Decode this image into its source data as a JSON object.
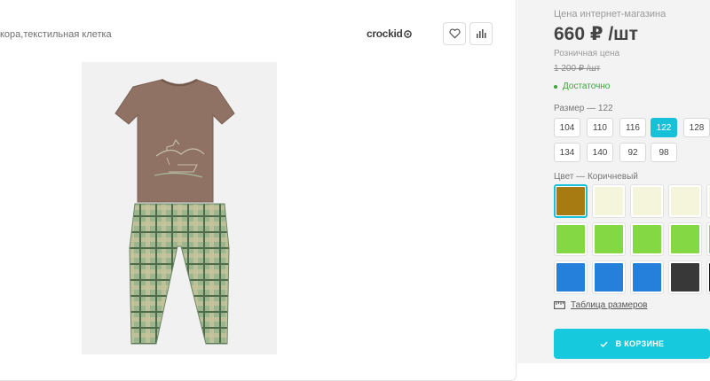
{
  "product": {
    "title": "кора,текстильная клетка",
    "brand": "crockid",
    "image_icon": "pajama-set-image"
  },
  "toolbar": {
    "favorite_icon": "heart-icon",
    "compare_icon": "bar-chart-icon"
  },
  "pricing": {
    "online_label": "Цена интернет-магазина",
    "online_price": "660 ₽ /шт",
    "retail_label": "Розничная цена",
    "retail_price": "1 200 ₽ /шт",
    "stock": "Достаточно"
  },
  "size": {
    "label": "Размер  —  122",
    "options": [
      "104",
      "110",
      "116",
      "122",
      "128",
      "134",
      "140",
      "92",
      "98"
    ],
    "selected": "122"
  },
  "color": {
    "label": "Цвет  —  Коричневый",
    "swatches": [
      "#a87a12",
      "#f5f5dc",
      "#f5f5dc",
      "#f5f5dc",
      "#f5f5dc",
      "#84d843",
      "#84d843",
      "#84d843",
      "#84d843",
      "#84d843",
      "#2580dc",
      "#2580dc",
      "#2580dc",
      "#383838",
      "#111111"
    ],
    "selected_index": 0
  },
  "size_table": {
    "icon": "ruler-icon",
    "label": "Таблица размеров"
  },
  "cart": {
    "icon": "checkmark-icon",
    "label": "В КОРЗИНЕ"
  },
  "colors": {
    "accent": "#17c1d7",
    "in_stock": "#3aa53a"
  }
}
